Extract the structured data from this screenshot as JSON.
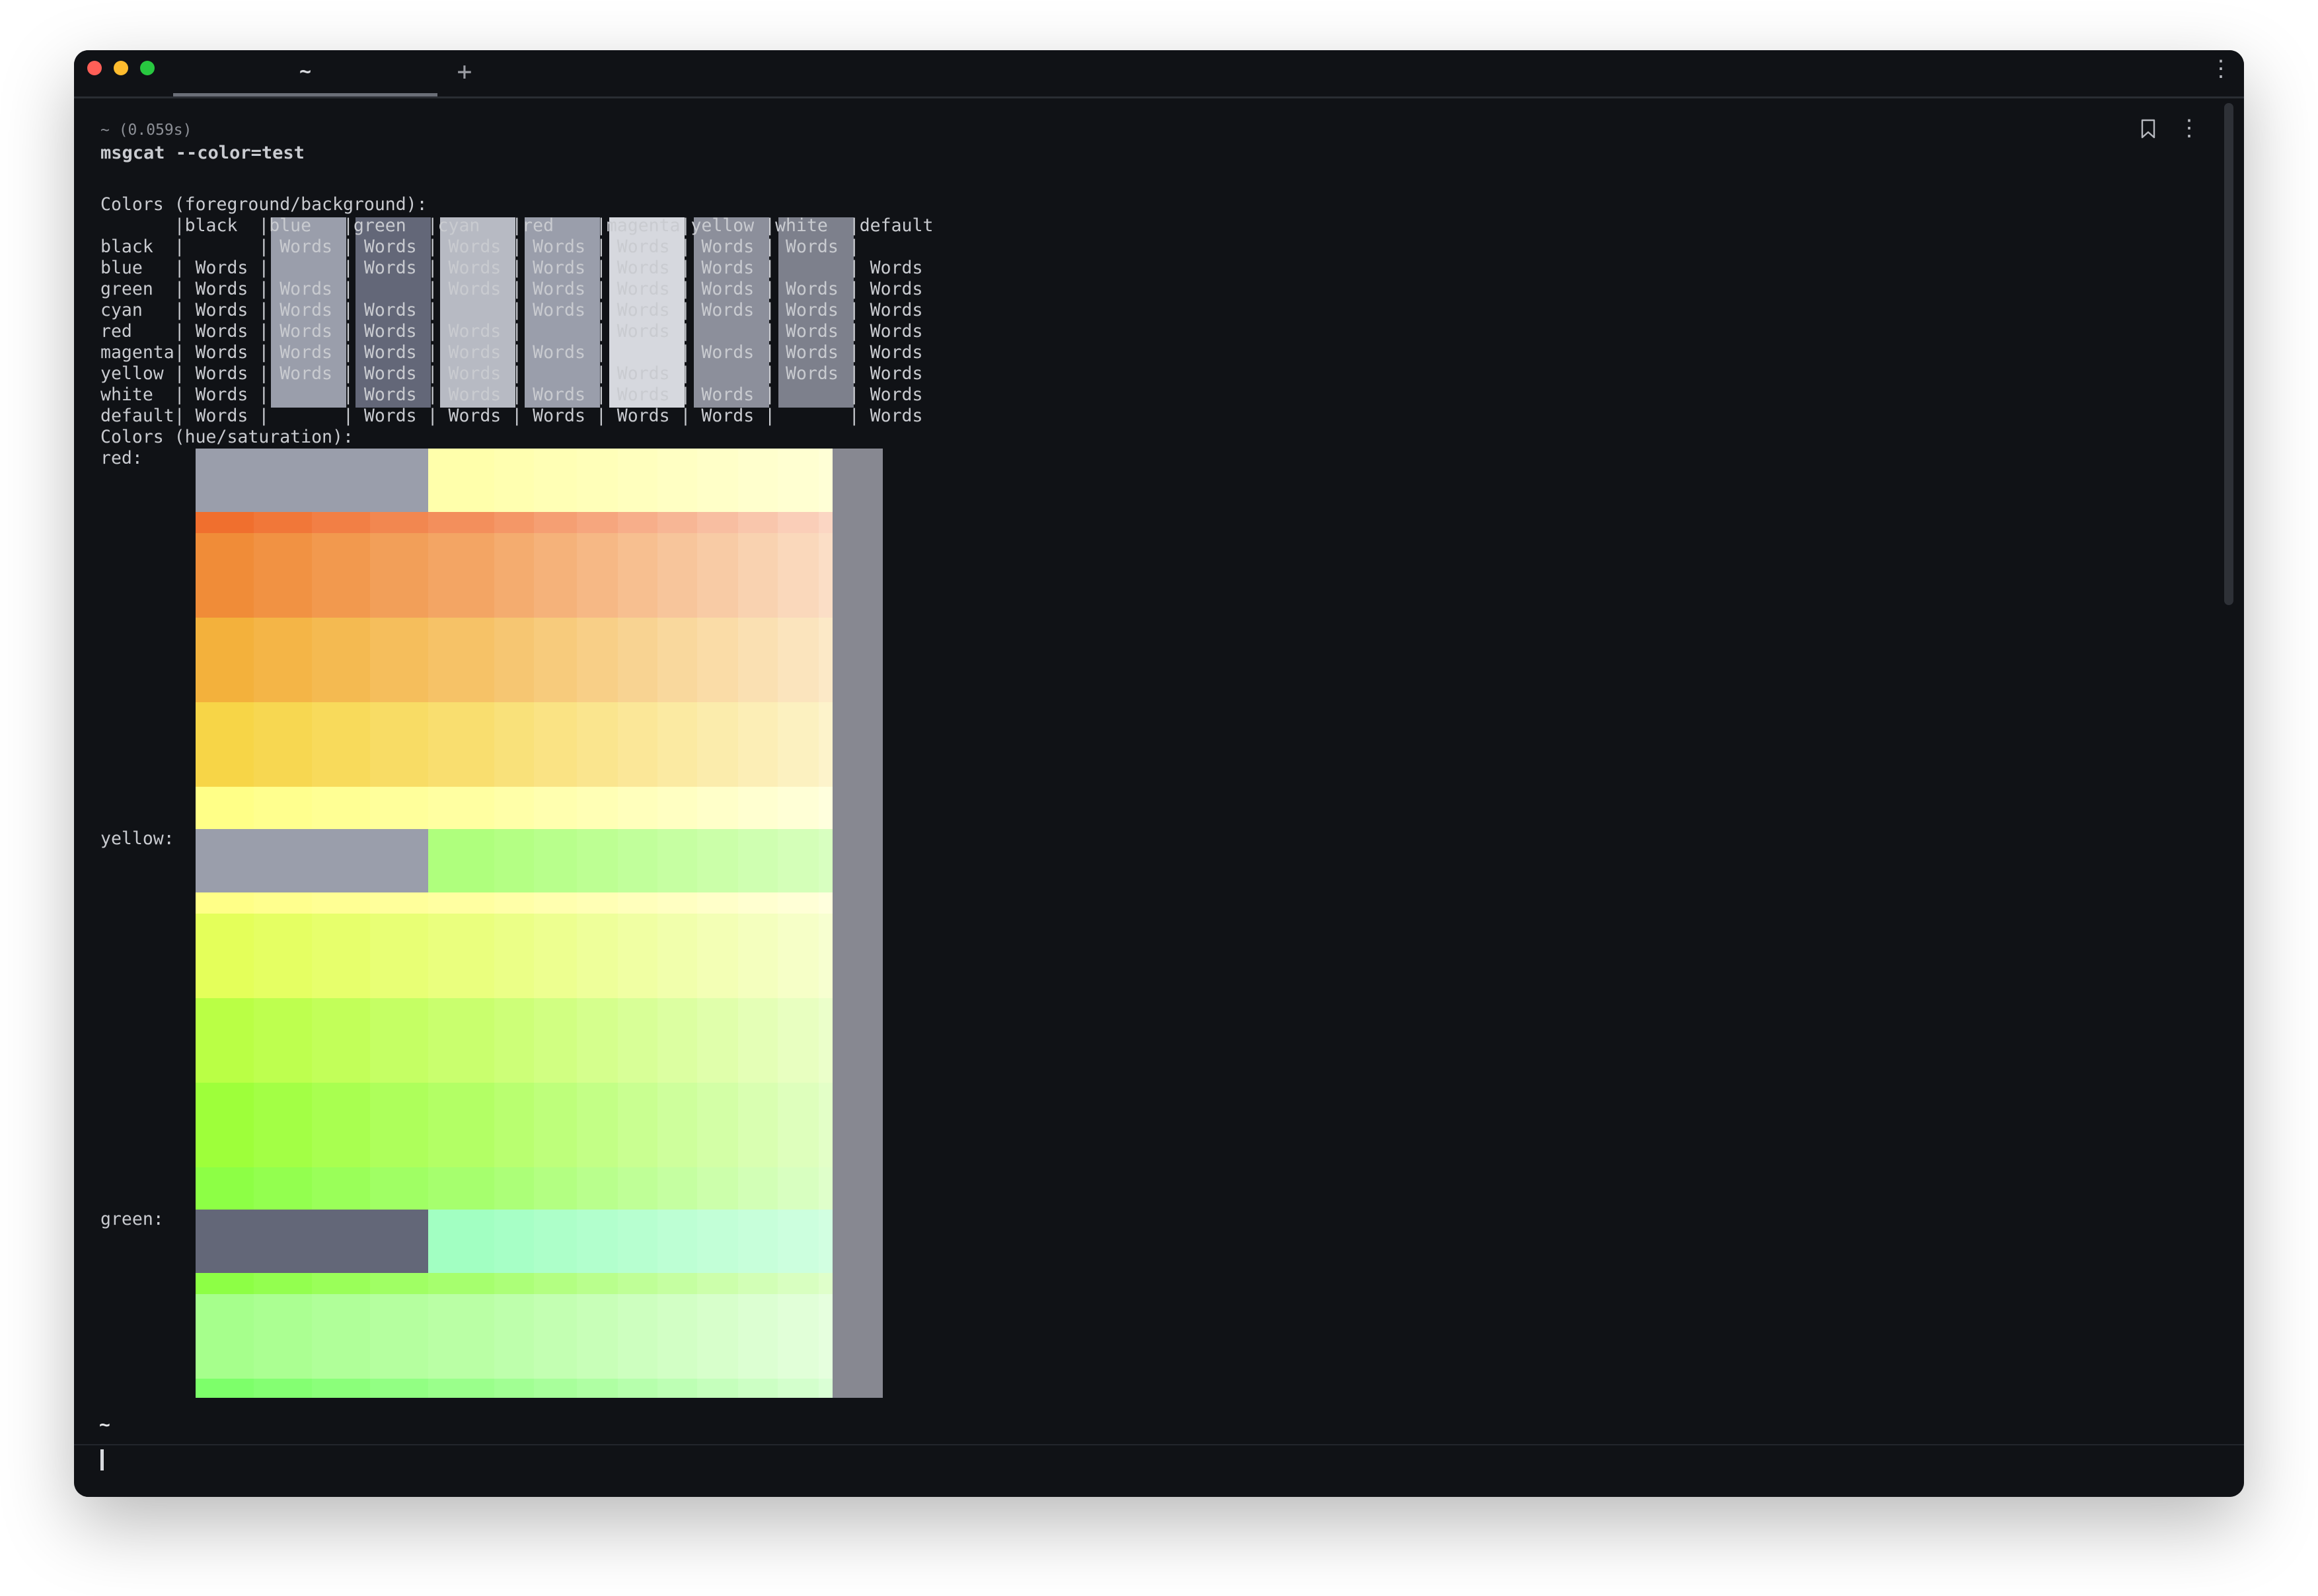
{
  "window": {
    "tab_title": "~",
    "new_tab_symbol": "+",
    "menu_symbol": "⋮"
  },
  "block": {
    "duration": "~ (0.059s)",
    "command": "msgcat --color=test",
    "fg_bg_heading": "Colors (foreground/background):",
    "fg_bg_table": "       |black  |blue   |green  |cyan   |red    |magenta|yellow |white  |default\nblack  |       | Words | Words | Words | Words | Words | Words | Words |\nblue   | Words |       | Words | Words | Words | Words | Words |       | Words\ngreen  | Words | Words |       | Words | Words | Words | Words | Words | Words\ncyan   | Words | Words | Words |       | Words | Words | Words | Words | Words\nred    | Words | Words | Words | Words |       | Words |       | Words | Words\nmagenta| Words | Words | Words | Words | Words |       | Words | Words | Words\nyellow | Words | Words | Words | Words |       | Words |       | Words | Words\nwhite  | Words |       | Words | Words | Words | Words | Words |       | Words\ndefault| Words |       | Words | Words | Words | Words | Words |       | Words",
    "hs_heading": "Colors (hue/saturation):",
    "hs_labels": [
      "red:",
      "yellow:",
      "green:"
    ]
  },
  "prompt": {
    "dir": "~"
  },
  "colors": {
    "window_bg": "#101216",
    "traffic_close": "#ff5f57",
    "traffic_min": "#febc2e",
    "traffic_max": "#28c840",
    "cell_gray": "#9a9eab",
    "cell_dark_gray": "#636778",
    "cell_light": "#d6d8de",
    "right_strip": "#878891",
    "row_colors": [
      "#f06f2e",
      "#f08c38",
      "#f3b13c",
      "#f7d547",
      "#ffff87",
      "#e4ff5a",
      "#baff45",
      "#9eff3a",
      "#8dff45",
      "#a6ff8c",
      "#7dff6a",
      "#76ff86",
      "#7affa8"
    ]
  }
}
